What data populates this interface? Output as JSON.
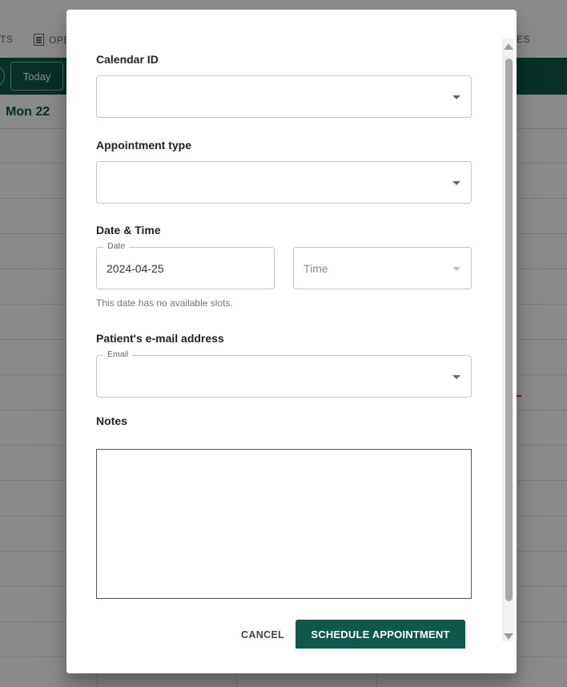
{
  "background": {
    "nav": {
      "left_fragment": "TS",
      "ops_fragment": "OPE",
      "right_fragment": "ES"
    },
    "toolbar": {
      "today_label": "Today"
    },
    "day_header": {
      "label": "Mon 22"
    }
  },
  "dialog": {
    "calendar_id": {
      "label": "Calendar ID",
      "value": ""
    },
    "appointment_type": {
      "label": "Appointment type",
      "value": ""
    },
    "date_time": {
      "label": "Date & Time",
      "date_field_label": "Date",
      "date_value": "2024-04-25",
      "time_placeholder": "Time",
      "helper_text": "This date has no available slots."
    },
    "patient_email": {
      "label": "Patient's e-mail address",
      "field_label": "Email",
      "value": ""
    },
    "notes": {
      "label": "Notes",
      "value": ""
    },
    "actions": {
      "cancel_label": "CANCEL",
      "schedule_label": "SCHEDULE APPOINTMENT"
    }
  },
  "colors": {
    "brand": "#10584b",
    "scrim": "rgba(0,0,0,0.46)"
  }
}
